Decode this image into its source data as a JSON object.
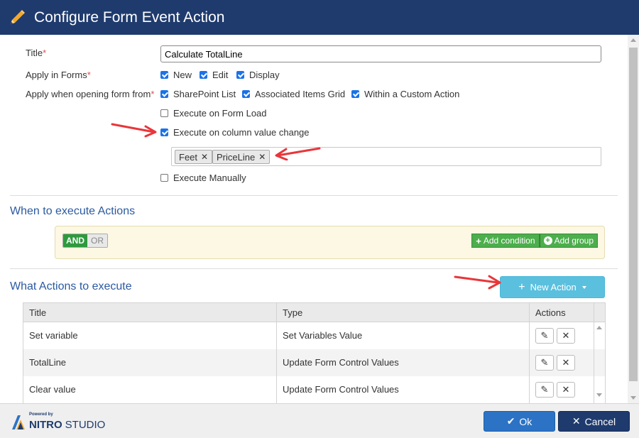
{
  "dialog": {
    "title": "Configure Form Event Action",
    "icon": "pencil-icon"
  },
  "form": {
    "title_label": "Title",
    "title_value": "Calculate TotalLine",
    "apply_forms_label": "Apply in Forms",
    "apply_forms": [
      {
        "label": "New",
        "checked": true
      },
      {
        "label": "Edit",
        "checked": true
      },
      {
        "label": "Display",
        "checked": true
      }
    ],
    "apply_opening_label": "Apply when opening form from",
    "apply_opening": [
      {
        "label": "SharePoint List",
        "checked": true
      },
      {
        "label": "Associated Items Grid",
        "checked": true
      },
      {
        "label": "Within a Custom Action",
        "checked": true
      }
    ],
    "execute_on_load": {
      "label": "Execute on Form Load",
      "checked": false
    },
    "execute_on_change": {
      "label": "Execute on column value change",
      "checked": true
    },
    "columns": [
      "Feet",
      "PriceLine"
    ],
    "execute_manually": {
      "label": "Execute Manually",
      "checked": false
    }
  },
  "when_section": {
    "title": "When to execute Actions",
    "and_label": "AND",
    "or_label": "OR",
    "add_condition_label": "Add condition",
    "add_group_label": "Add group"
  },
  "what_section": {
    "title": "What Actions to execute",
    "new_action_label": "New Action"
  },
  "table": {
    "headers": [
      "Title",
      "Type",
      "Actions"
    ],
    "rows": [
      {
        "title": "Set variable",
        "type": "Set Variables Value"
      },
      {
        "title": "TotalLine",
        "type": "Update Form Control Values"
      },
      {
        "title": "Clear value",
        "type": "Update Form Control Values"
      }
    ]
  },
  "footer": {
    "powered_by": "Powered by",
    "brand_bold": "NITRO",
    "brand_light": "STUDIO",
    "ok_label": "Ok",
    "cancel_label": "Cancel"
  },
  "colors": {
    "header_bg": "#1f3b6e",
    "accent_blue": "#2d73c5",
    "info_button": "#5bc0de",
    "success_green": "#4cae4c",
    "annotation_red": "#e8363a"
  }
}
